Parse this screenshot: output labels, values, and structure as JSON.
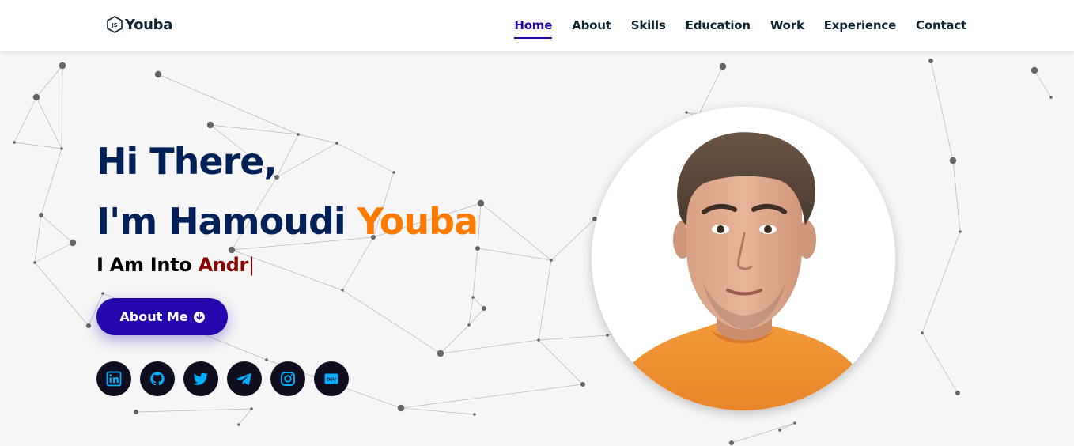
{
  "header": {
    "logo_badge": "JS",
    "logo_text": "Youba",
    "nav": [
      {
        "label": "Home",
        "active": true
      },
      {
        "label": "About",
        "active": false
      },
      {
        "label": "Skills",
        "active": false
      },
      {
        "label": "Education",
        "active": false
      },
      {
        "label": "Work",
        "active": false
      },
      {
        "label": "Experience",
        "active": false
      },
      {
        "label": "Contact",
        "active": false
      }
    ]
  },
  "hero": {
    "greeting": "Hi There,",
    "intro": "I'm Hamoudi ",
    "name_highlight": "Youba",
    "typed_prefix": "I Am Into ",
    "typed_word": "Andr",
    "cursor": "|",
    "about_button": "About Me",
    "about_button_icon": "arrow-circle-down-icon"
  },
  "socials": [
    {
      "name": "linkedin-icon"
    },
    {
      "name": "github-icon"
    },
    {
      "name": "twitter-icon"
    },
    {
      "name": "telegram-icon"
    },
    {
      "name": "instagram-icon"
    },
    {
      "name": "dev-icon",
      "label": "DEV"
    }
  ],
  "colors": {
    "heading": "#002057",
    "accent": "#ff7b00",
    "primary": "#2506ad",
    "typed": "#8b0000",
    "social_bg": "#0e0e1f",
    "social_icon": "#00aeff",
    "background": "#f6f6f6"
  }
}
